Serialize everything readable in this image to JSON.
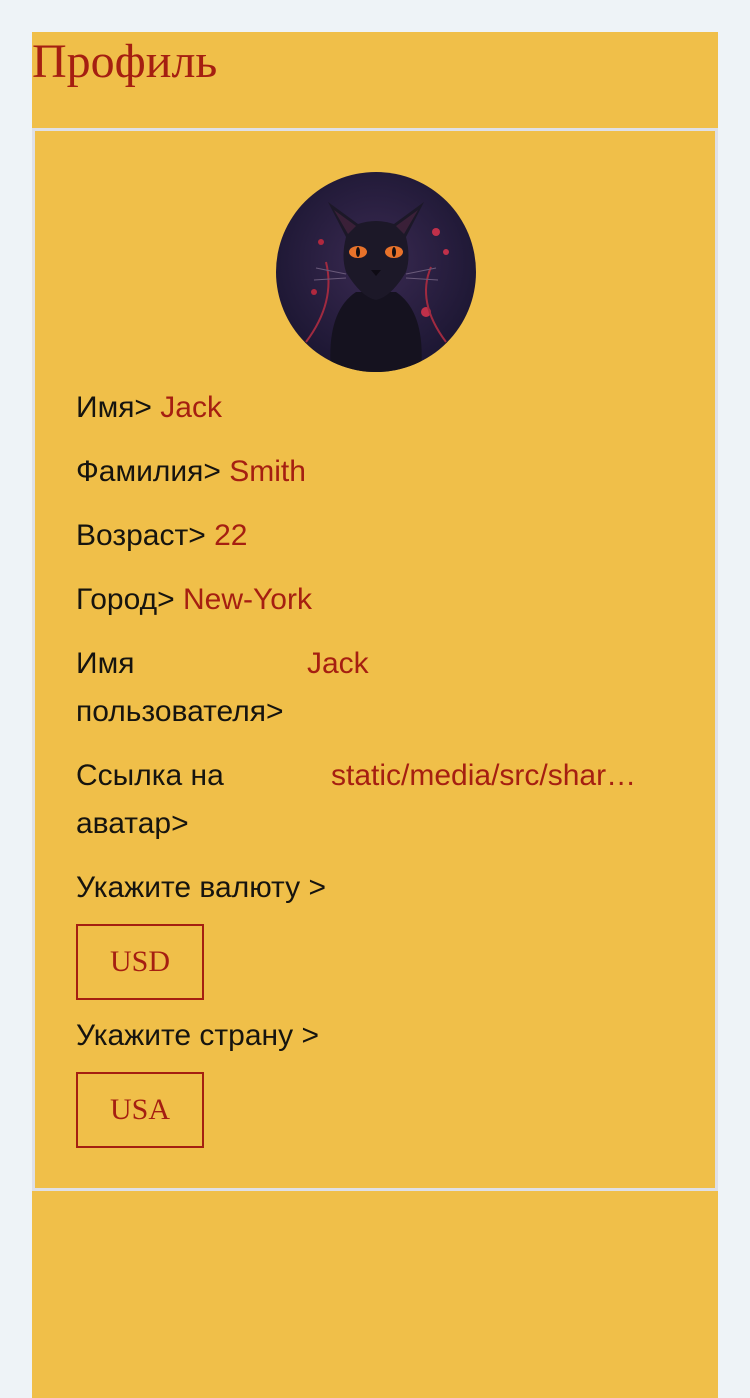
{
  "page": {
    "title": "Профиль"
  },
  "profile": {
    "avatar": {
      "icon": "black-cat-avatar"
    },
    "fields": {
      "first_name": {
        "label": "Имя>",
        "value": "Jack"
      },
      "last_name": {
        "label": "Фамилия>",
        "value": "Smith"
      },
      "age": {
        "label": "Возраст>",
        "value": "22"
      },
      "city": {
        "label": "Город>",
        "value": "New-York"
      },
      "username": {
        "label": "Имя пользователя>",
        "value": "Jack"
      },
      "avatar_link": {
        "label": "Ссылка на аватар>",
        "value": "static/media/src/shar…"
      }
    },
    "currency": {
      "label": "Укажите валюту >",
      "selected": "USD"
    },
    "country": {
      "label": "Укажите страну >",
      "selected": "USA"
    }
  },
  "colors": {
    "background": "#eef3f7",
    "panel": "#f0bf49",
    "accent": "#a51f11",
    "text": "#16140f",
    "card_border": "#dfe0e6"
  }
}
